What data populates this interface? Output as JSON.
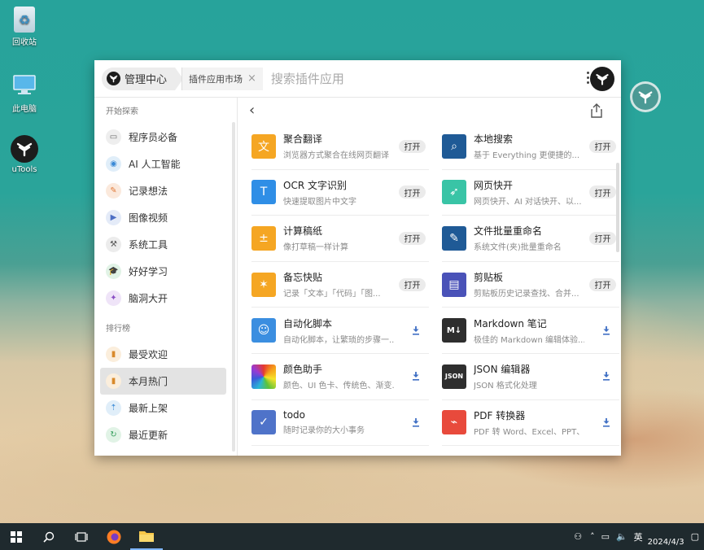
{
  "desktop": {
    "icons": [
      {
        "label": "回收站"
      },
      {
        "label": "此电脑"
      },
      {
        "label": "uTools"
      }
    ]
  },
  "header": {
    "home_tab": "管理中心",
    "market_tab": "插件应用市场",
    "search_placeholder": "搜索插件应用"
  },
  "sidebar": {
    "section_explore": "开始探索",
    "explore_items": [
      {
        "label": "程序员必备",
        "icon": "monitor-icon"
      },
      {
        "label": "AI 人工智能",
        "icon": "eye-icon"
      },
      {
        "label": "记录想法",
        "icon": "pencil-icon"
      },
      {
        "label": "图像视频",
        "icon": "play-icon"
      },
      {
        "label": "系统工具",
        "icon": "toolbox-icon"
      },
      {
        "label": "好好学习",
        "icon": "graduation-cap-icon"
      },
      {
        "label": "脑洞大开",
        "icon": "bulb-icon"
      }
    ],
    "section_ranking": "排行榜",
    "ranking_items": [
      {
        "label": "最受欢迎",
        "icon": "bar-chart-icon"
      },
      {
        "label": "本月热门",
        "icon": "bar-chart-icon",
        "active": true
      },
      {
        "label": "最新上架",
        "icon": "upload-icon"
      },
      {
        "label": "最近更新",
        "icon": "refresh-icon"
      }
    ]
  },
  "plugins": [
    {
      "name": "聚合翻译",
      "desc": "浏览器方式聚合在线网页翻译",
      "action": "打开",
      "installed": true,
      "color": "#f5a623",
      "icon": "translate-icon"
    },
    {
      "name": "本地搜索",
      "desc": "基于 Everything 更便捷的...",
      "action": "打开",
      "installed": true,
      "color": "#1f5a96",
      "icon": "magnifier-icon"
    },
    {
      "name": "OCR 文字识别",
      "desc": "快速提取图片中文字",
      "action": "打开",
      "installed": true,
      "color": "#2f8ee6",
      "icon": "ocr-icon"
    },
    {
      "name": "网页快开",
      "desc": "网页快开、AI 对话快开、以...",
      "action": "打开",
      "installed": true,
      "color": "#39c4a6",
      "icon": "rocket-icon"
    },
    {
      "name": "计算稿纸",
      "desc": "像打草稿一样计算",
      "action": "打开",
      "installed": true,
      "color": "#f5a623",
      "icon": "calculator-icon"
    },
    {
      "name": "文件批量重命名",
      "desc": "系统文件(夹)批量重命名",
      "action": "打开",
      "installed": true,
      "color": "#1f5a96",
      "icon": "rename-pen-icon"
    },
    {
      "name": "备忘快贴",
      "desc": "记录「文本」「代码」「图...",
      "action": "打开",
      "installed": true,
      "color": "#f5a623",
      "icon": "pin-icon"
    },
    {
      "name": "剪贴板",
      "desc": "剪贴板历史记录查找、合并...",
      "action": "打开",
      "installed": true,
      "color": "#4a52b8",
      "icon": "clipboard-icon"
    },
    {
      "name": "自动化脚本",
      "desc": "自动化脚本，让繁琐的步骤一...",
      "action": "",
      "installed": false,
      "color": "#3b8ee0",
      "icon": "robot-icon"
    },
    {
      "name": "Markdown 笔记",
      "desc": "极佳的 Markdown 编辑体验...",
      "action": "",
      "installed": false,
      "color": "#2e2e2e",
      "icon": "markdown-icon"
    },
    {
      "name": "颜色助手",
      "desc": "颜色、UI 色卡、传统色、渐变...",
      "action": "",
      "installed": false,
      "color": "#e64a3b",
      "icon": "color-wheel-icon"
    },
    {
      "name": "JSON 编辑器",
      "desc": "JSON 格式化处理",
      "action": "",
      "installed": false,
      "color": "#2e2e2e",
      "icon": "json-icon"
    },
    {
      "name": "todo",
      "desc": "随时记录你的大小事务",
      "action": "",
      "installed": false,
      "color": "#4f73c9",
      "icon": "check-icon"
    },
    {
      "name": "PDF 转换器",
      "desc": "PDF 转 Word、Excel、PPT、...",
      "action": "",
      "installed": false,
      "color": "#e84a3c",
      "icon": "pdf-icon"
    }
  ],
  "taskbar": {
    "date": "2024/4/3",
    "input_method": "英"
  }
}
